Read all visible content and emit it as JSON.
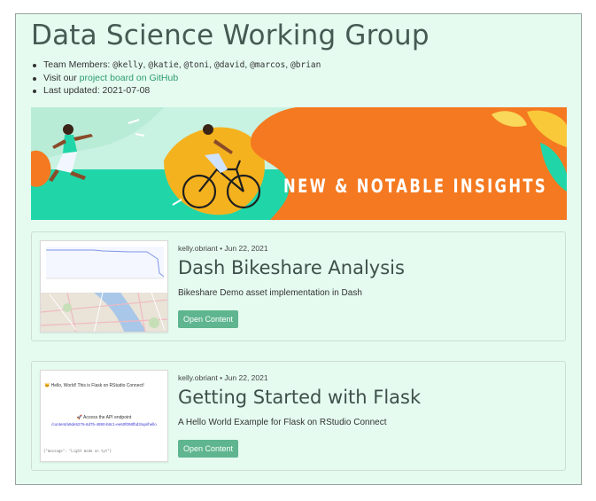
{
  "page": {
    "title": "Data Science Working Group",
    "team_label": "Team Members: ",
    "members": [
      "@kelly",
      "@katie",
      "@toni",
      "@david",
      "@marcos",
      "@brian"
    ],
    "visit_prefix": "Visit our ",
    "project_link": "project board on GitHub",
    "updated": "Last updated: 2021-07-08"
  },
  "banner": {
    "text": "NEW & NOTABLE INSIGHTS",
    "colors": {
      "orange": "#f47920",
      "teal": "#20d6a9",
      "mint": "#c8f2e1",
      "yellow": "#f5b21f"
    }
  },
  "cards": [
    {
      "meta": "kelly.obriant • Jun 22, 2021",
      "title": "Dash Bikeshare Analysis",
      "desc": "Bikeshare Demo asset implementation in Dash",
      "button": "Open Content"
    },
    {
      "meta": "kelly.obriant • Jun 22, 2021",
      "title": "Getting Started with Flask",
      "desc": "A Hello World Example for Flask on RStudio Connect",
      "button": "Open Content",
      "thumb": {
        "heading": "🐱 Hello, World! This is Flask on RStudio Connect!",
        "api": "🚀 Access the API endpoint",
        "link": "/content/a9de5276-6d7b-4890-b8c1-ee60f098fbd3/api/hello",
        "code": "{\"message\": \"Light mode on tyt\"}"
      }
    }
  ],
  "accent_color": "#5eb58f",
  "background_color": "#e5fbf0"
}
